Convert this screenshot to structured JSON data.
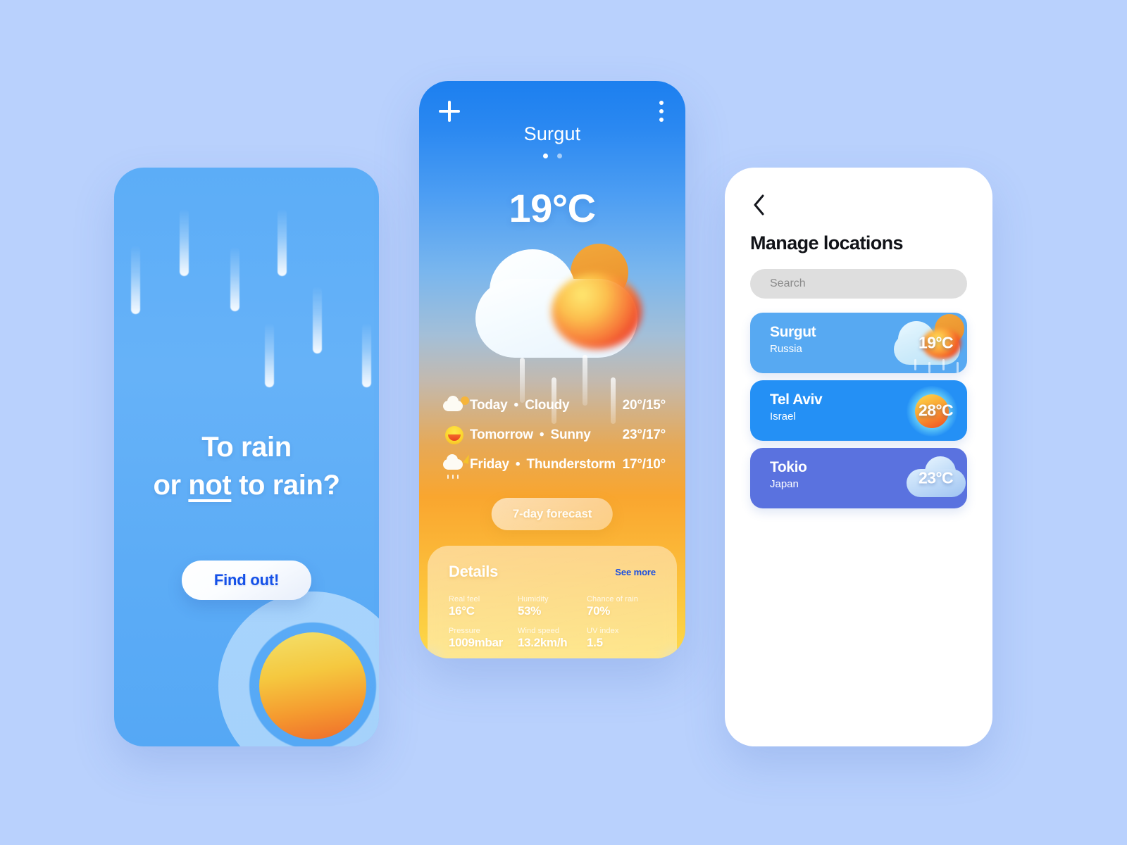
{
  "background_color": "#b9d1fd",
  "onboarding": {
    "headline_line1": "To rain",
    "headline_line2_pre": "or ",
    "headline_line2_underline": "not",
    "headline_line2_post": " to rain?",
    "cta_label": "Find out!",
    "cta_text_color": "#1551E8",
    "panel_color": "#5CADF7"
  },
  "main": {
    "add_icon": "plus-icon",
    "menu_icon": "more-vertical-icon",
    "city": "Surgut",
    "page_dots": {
      "count": 2,
      "active_index": 0
    },
    "temperature": "19°C",
    "hero_icon": "sun-behind-rain-cloud-icon",
    "forecast": [
      {
        "icon": "cloud-sun-icon",
        "day": "Today",
        "sep": "•",
        "condition": "Cloudy",
        "temps": "20°/15°"
      },
      {
        "icon": "sun-icon",
        "day": "Tomorrow",
        "sep": "•",
        "condition": "Sunny",
        "temps": "23°/17°"
      },
      {
        "icon": "thunderstorm-icon",
        "day": "Friday",
        "sep": "•",
        "condition": "Thunderstorm",
        "temps": "17°/10°"
      }
    ],
    "forecast_button_label": "7-day forecast",
    "details": {
      "title": "Details",
      "see_more_label": "See more",
      "see_more_color": "#1B4FE0",
      "items": [
        {
          "key": "Real feel",
          "value": "16°C"
        },
        {
          "key": "Humidity",
          "value": "53%"
        },
        {
          "key": "Chance of rain",
          "value": "70%"
        },
        {
          "key": "Pressure",
          "value": "1009mbar"
        },
        {
          "key": "Wind speed",
          "value": "13.2km/h"
        },
        {
          "key": "UV index",
          "value": "1.5"
        }
      ]
    }
  },
  "locations": {
    "back_icon": "chevron-left-icon",
    "title": "Manage locations",
    "search": {
      "value": "",
      "placeholder": "Search"
    },
    "cards": [
      {
        "city": "Surgut",
        "country": "Russia",
        "temp": "19",
        "unit": "°C",
        "color": "#57A9F2",
        "icon": "sun-behind-rain-cloud-icon"
      },
      {
        "city": "Tel Aviv",
        "country": "Israel",
        "temp": "28",
        "unit": "°C",
        "color": "#2490F5",
        "icon": "sun-icon"
      },
      {
        "city": "Tokio",
        "country": "Japan",
        "temp": "23",
        "unit": "°C",
        "color": "#5A72DF",
        "icon": "cloud-icon"
      }
    ]
  }
}
